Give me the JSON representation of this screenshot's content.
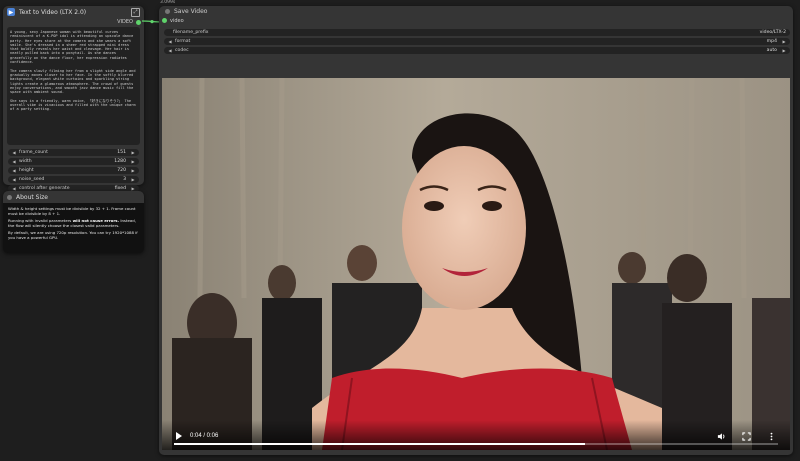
{
  "text_to_video": {
    "title": "Text to Video (LTX 2.0)",
    "output_label": "VIDEO",
    "prompt": "A young, sexy Japanese woman with beautiful curves reminiscent of a K-POP idol is attending an upscale dance party. Her eyes stare at the camera and she wears a soft smile. She's dressed in a sheer red strapped mini dress that boldly reveals her waist and cleavage. Her hair is neatly pulled back into a ponytail. As she dances gracefully on the dance floor, her expression radiates confidence.\n\nThe camera slowly filming her from a slight side angle and gradually moves closer to her face. In the softly blurred background, elegant white curtains and sparkling string lights create a glamorous atmosphere. The crowd of guests enjoy conversations, and smooth jazz dance music fill the space with ambient sound.\n\nShe says in a friendly, warm voice, 「好きになりそう?」 The overall vibe is vivacious and filled with the unique charm of a party setting.",
    "widgets": [
      {
        "label": "frame_count",
        "value": "151"
      },
      {
        "label": "width",
        "value": "1280"
      },
      {
        "label": "height",
        "value": "720"
      },
      {
        "label": "noise_seed",
        "value": "3"
      },
      {
        "label": "control after generate",
        "value": "fixed"
      }
    ]
  },
  "about_size": {
    "title": "About Size",
    "paragraphs": [
      "Width & height settings must be divisible by 32 + 1. Frame count must be divisible by 8 + 1.",
      "Instead, the flow will silently choose the closest valid parameters.",
      "By default, we are using 720p resolution. You can try 1920*1088 if you have a powerful GPU."
    ],
    "p2_lead": "Running with invalid parameters ",
    "p2_bold": "will not cause errors."
  },
  "save_video": {
    "badge": "3.099s",
    "title": "Save Video",
    "input_label": "video",
    "widgets": [
      {
        "label": "filename_prefix",
        "value": "video/LTX-2"
      },
      {
        "label": "format",
        "value": "mp4"
      },
      {
        "label": "codec",
        "value": "auto"
      }
    ],
    "player": {
      "time": "0:04 / 0:06",
      "progress": 0.68
    }
  },
  "colors": {
    "link": "#5fd36b",
    "badge": "#4a82d8",
    "node_bg": "#353535",
    "canvas_bg": "#1e1e1e"
  }
}
